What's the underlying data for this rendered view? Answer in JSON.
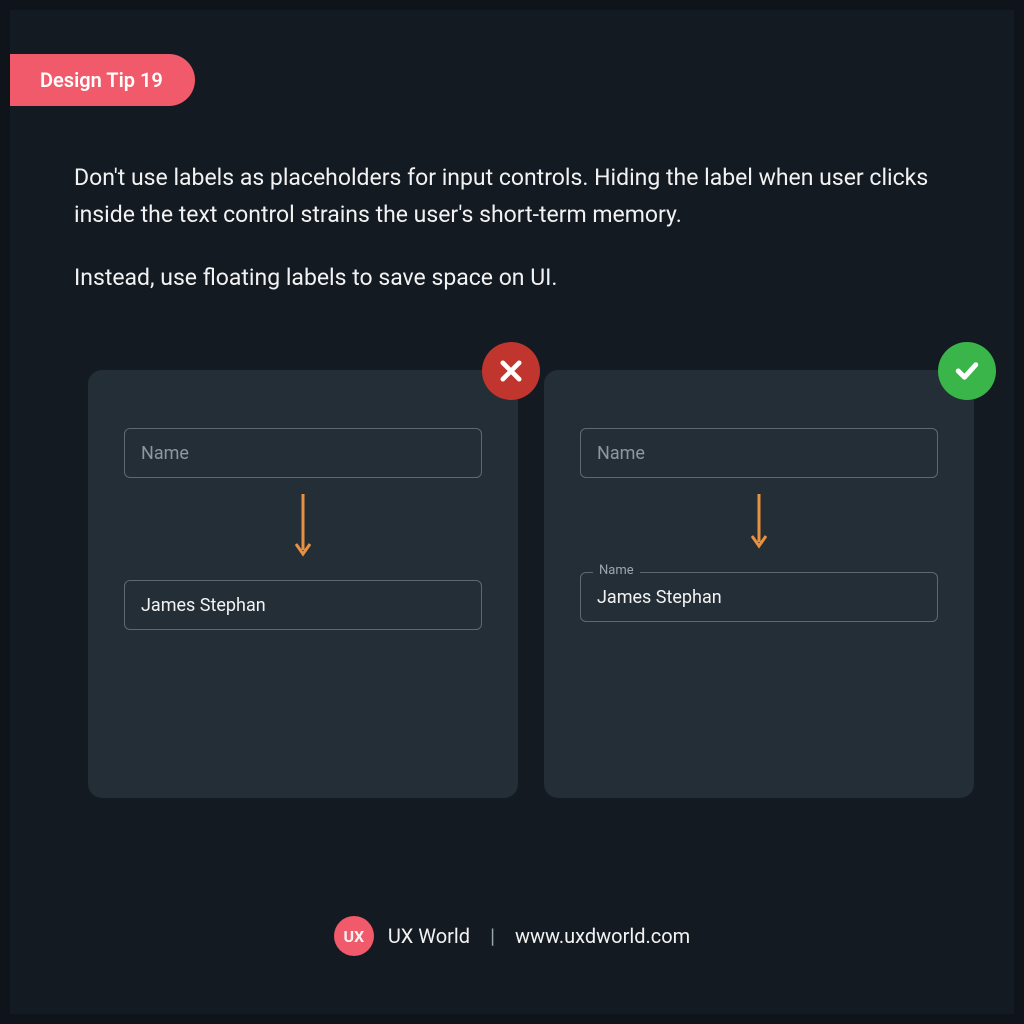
{
  "badge": {
    "label": "Design Tip 19"
  },
  "tip": {
    "paragraph1": "Don't use labels as placeholders for input controls. Hiding the label when user clicks inside the text control strains the user's short-term memory.",
    "paragraph2": "Instead, use floating labels to save space on UI."
  },
  "examples": {
    "bad": {
      "before_placeholder": "Name",
      "after_value": "James Stephan"
    },
    "good": {
      "before_placeholder": "Name",
      "after_float_label": "Name",
      "after_value": "James Stephan"
    }
  },
  "footer": {
    "logo_text": "UX",
    "brand": "UX World",
    "separator": "|",
    "url": "www.uxdworld.com"
  },
  "colors": {
    "accent": "#f05a6a",
    "panel": "#242e37",
    "bg": "#131a22",
    "bad": "#c0362e",
    "good": "#39b54a",
    "arrow": "#e8913f"
  }
}
